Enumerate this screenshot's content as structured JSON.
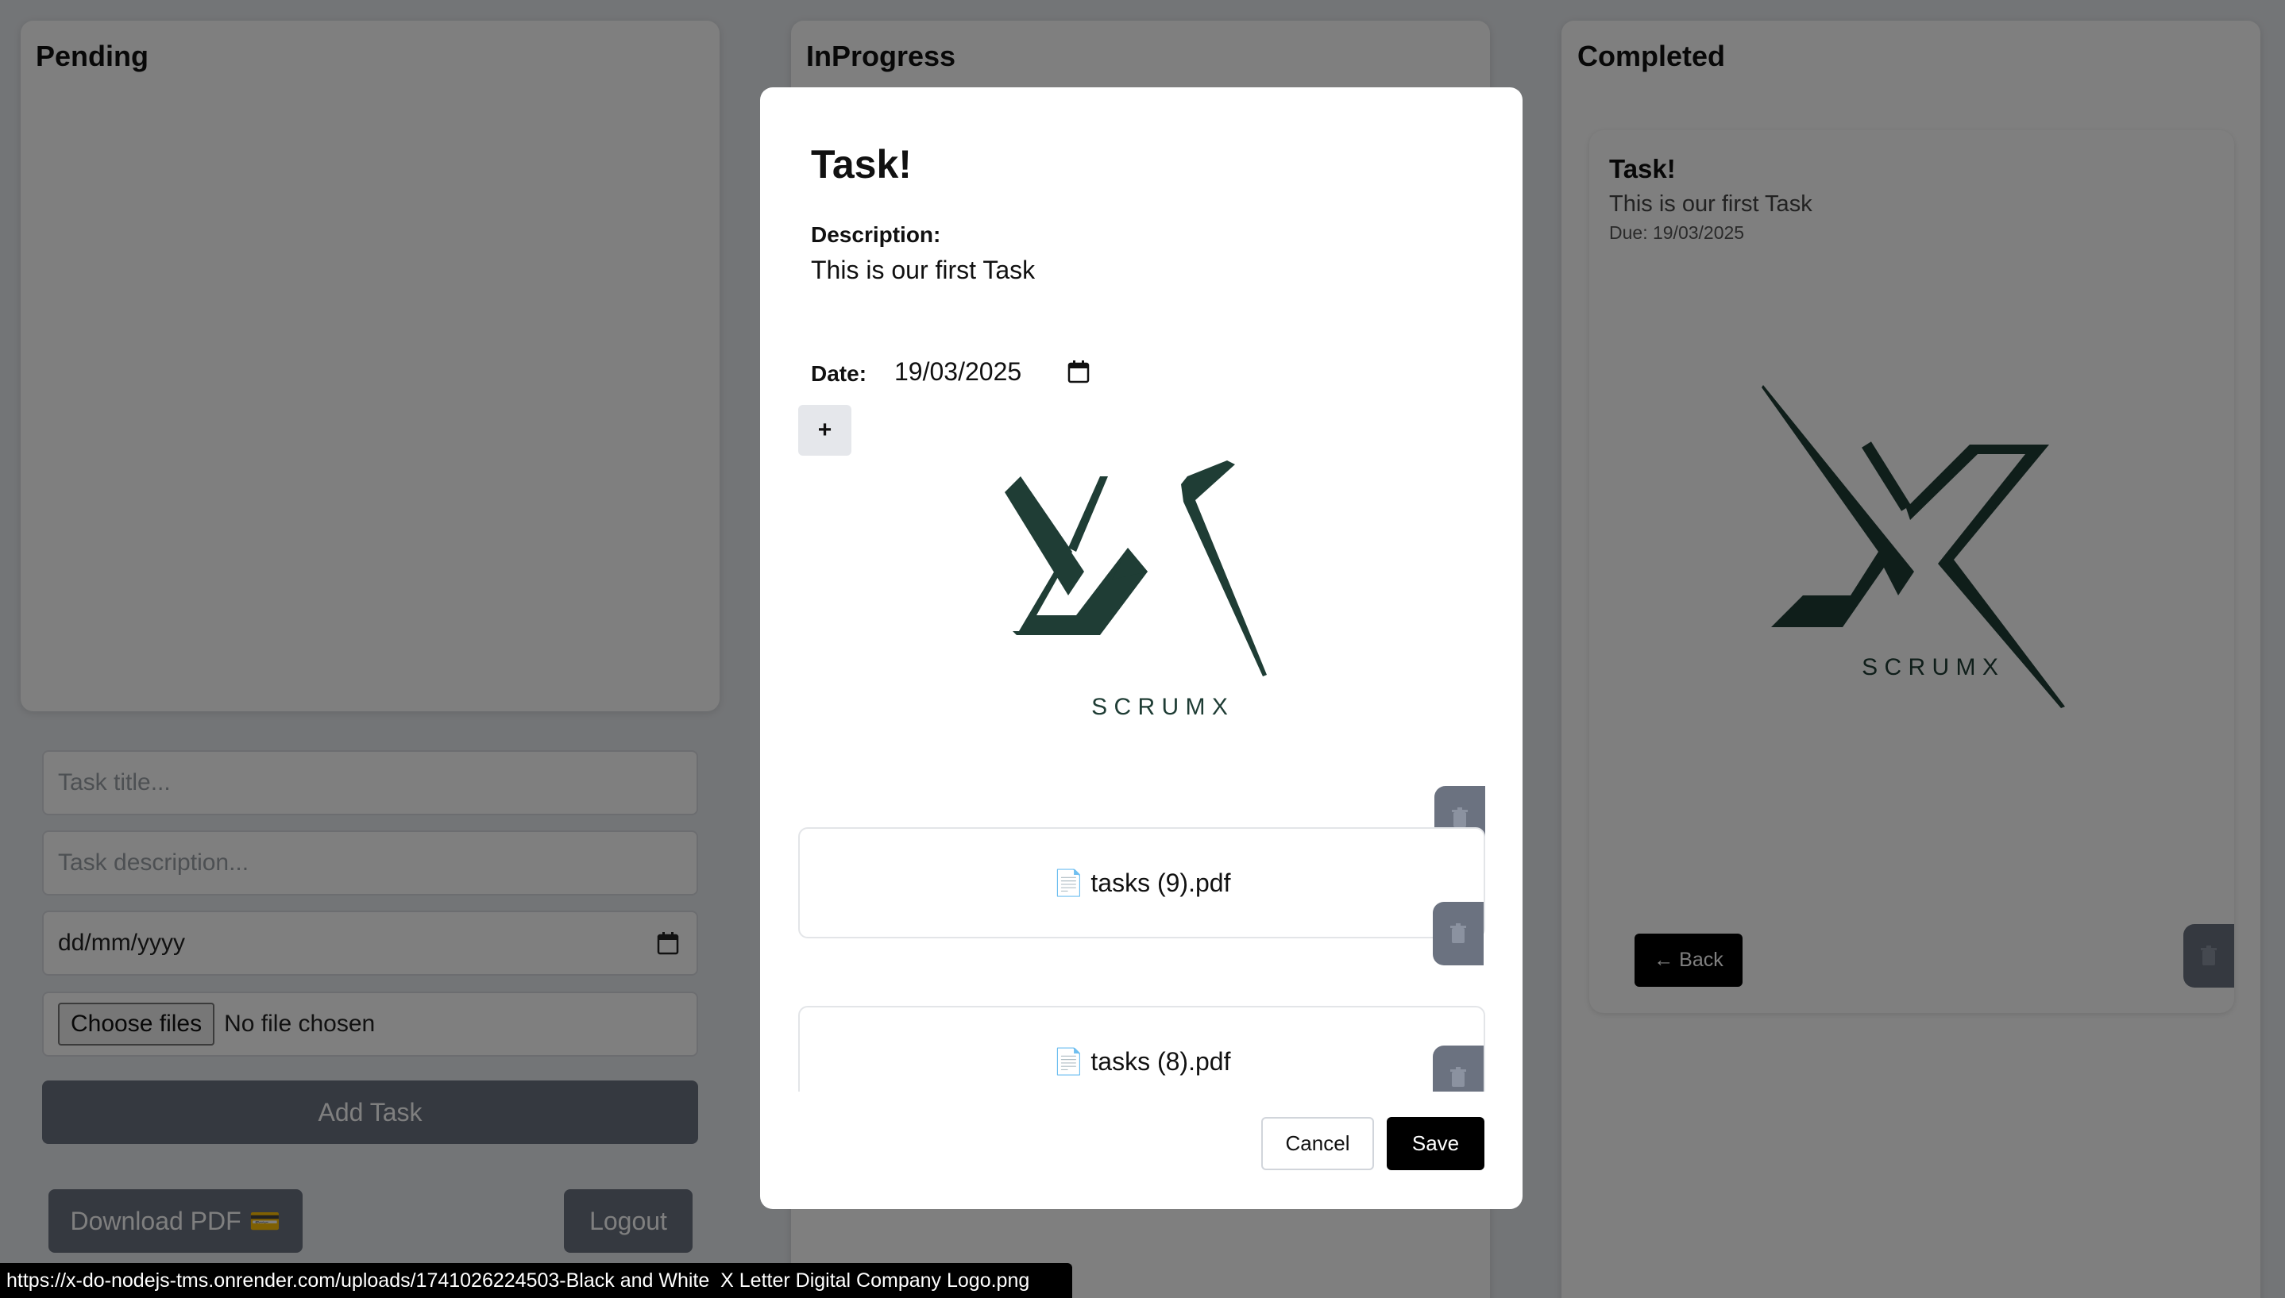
{
  "columns": {
    "pending": "Pending",
    "inprogress": "InProgress",
    "completed": "Completed"
  },
  "form": {
    "title_placeholder": "Task title...",
    "desc_placeholder": "Task description...",
    "date_placeholder": "dd/mm/yyyy",
    "choose_files": "Choose files",
    "no_file": "No file chosen",
    "add_task": "Add Task",
    "download_pdf": "Download PDF",
    "download_icon": "💳",
    "logout": "Logout"
  },
  "completed_card": {
    "title": "Task!",
    "description": "This is our first Task",
    "due": "Due: 19/03/2025",
    "back": "← Back",
    "logo_text": "S C R U M X"
  },
  "modal": {
    "title": "Task!",
    "description_label": "Description:",
    "description": "This is our first Task",
    "date_label": "Date:",
    "date": "19/03/2025",
    "plus": "+",
    "logo_text": "S C R U M X",
    "files": [
      "tasks (9).pdf",
      "tasks (8).pdf"
    ],
    "cancel": "Cancel",
    "save": "Save"
  },
  "statusbar": {
    "url": "https://x-do-nodejs-tms.onrender.com/uploads/1741026224503-Black and White  X Letter Digital Company Logo.png"
  },
  "colors": {
    "logo": "#1f3d35",
    "trash_bg": "#6b7280",
    "primary": "#000000"
  }
}
